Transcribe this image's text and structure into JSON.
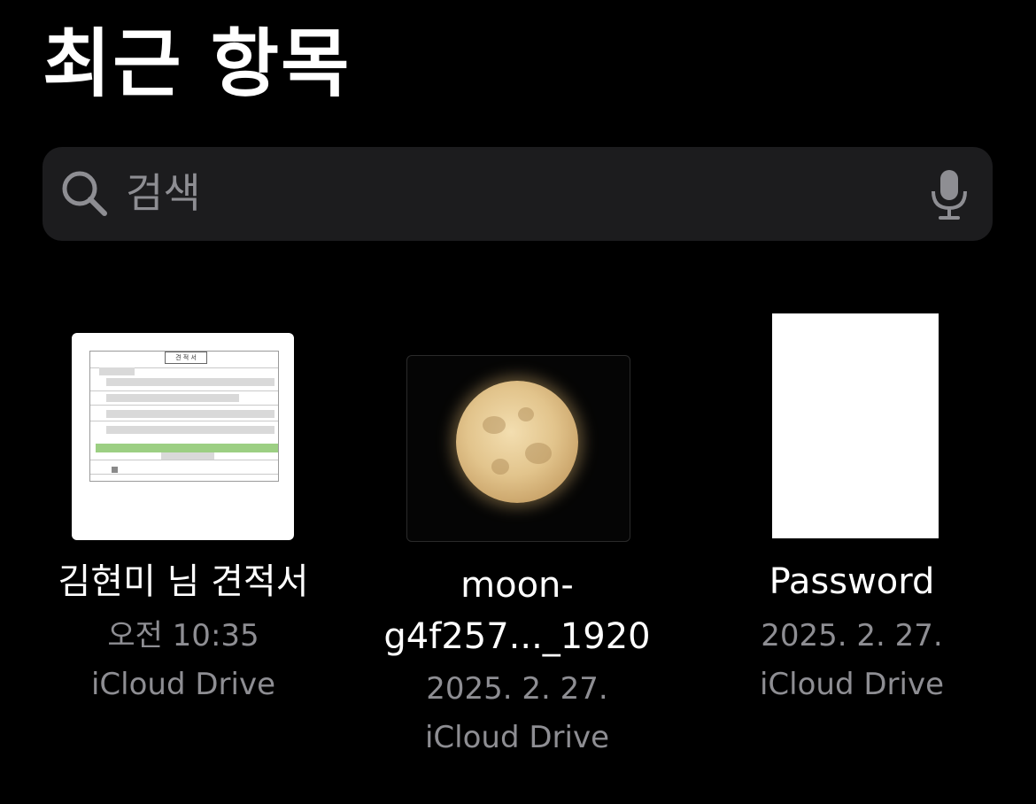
{
  "header": {
    "title": "최근 항목"
  },
  "search": {
    "placeholder": "검색",
    "icon": "search-icon",
    "mic_icon": "microphone-icon"
  },
  "files": [
    {
      "name": "김현미 님 견적서",
      "meta1": "오전 10:35",
      "meta2": "iCloud Drive",
      "thumb_header": "견 적 서"
    },
    {
      "name": "moon-g4f257..._1920",
      "name_line1": "moon-",
      "name_line2": "g4f257..._1920",
      "meta1": "2025. 2. 27.",
      "meta2": "iCloud Drive"
    },
    {
      "name": "Password",
      "meta1": "2025. 2. 27.",
      "meta2": "iCloud Drive"
    }
  ],
  "colors": {
    "background": "#000000",
    "search_field": "#1c1c1e",
    "secondary_text": "#8e8e93"
  }
}
